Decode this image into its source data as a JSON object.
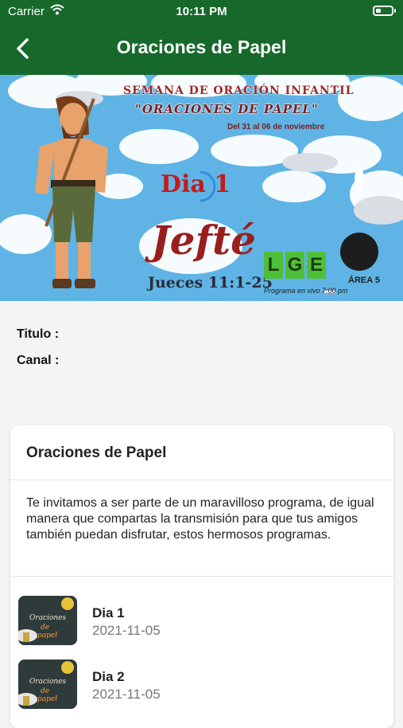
{
  "status_bar": {
    "carrier": "Carrier",
    "time": "10:11 PM"
  },
  "nav": {
    "title": "Oraciones de Papel",
    "back_icon": "chevron-left-icon"
  },
  "banner": {
    "line1": "SEMANA DE ORACIÓN INFANTIL",
    "line2": "\"ORACIONES DE PAPEL\"",
    "dates": "Del 31 al 06 de noviembre",
    "day": "Dia 1",
    "character": "Jefté",
    "verse": "Jueces 11:1-25",
    "program": "Programa en vivo 7:00 pm",
    "lge_letters": [
      "L",
      "G",
      "E"
    ],
    "area_label": "ÁREA 5"
  },
  "info": {
    "titulo_label": "Titulo :",
    "canal_label": "Canal :"
  },
  "card": {
    "title": "Oraciones de Papel",
    "description": "Te invitamos a ser parte de un maravilloso programa, de igual manera que compartas la transmisión para que tus amigos también puedan disfrutar, estos hermosos programas.",
    "items": [
      {
        "name": "Dia 1",
        "date": "2021-11-05"
      },
      {
        "name": "Dia 2",
        "date": "2021-11-05"
      }
    ]
  },
  "colors": {
    "header_green": "#16692b",
    "background": "#f4f4f4",
    "sky_blue": "#5fb4e5"
  }
}
